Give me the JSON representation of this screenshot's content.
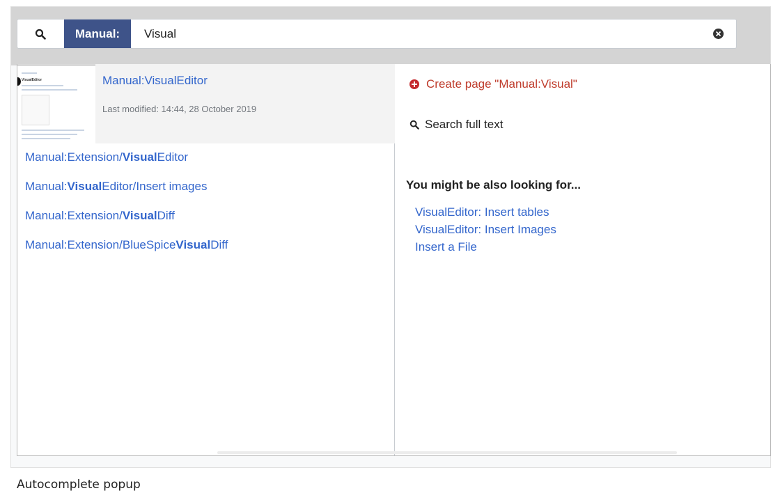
{
  "search": {
    "namespace_badge": "Manual:",
    "query": "Visual",
    "search_icon": "search-icon",
    "clear_icon": "clear-icon"
  },
  "top_result": {
    "title": "Manual:VisualEditor",
    "meta": "Last modified: 14:44, 28 October 2019",
    "thumbnail_title": "VisualEditor"
  },
  "results": [
    {
      "prefix": "Manual:Extension/",
      "match": "Visual",
      "suffix": "Editor"
    },
    {
      "prefix": "Manual:",
      "match": "Visual",
      "suffix": "Editor/Insert images"
    },
    {
      "prefix": "Manual:Extension/",
      "match": "Visual",
      "suffix": "Diff"
    },
    {
      "prefix": "Manual:Extension/BlueSpice",
      "match": "Visual",
      "suffix": "Diff"
    }
  ],
  "actions": {
    "create_page": "Create page \"Manual:Visual\"",
    "create_icon": "plus-circle-icon",
    "search_full_text": "Search full text"
  },
  "related": {
    "heading": "You might be also looking for...",
    "links": [
      "VisualEditor: Insert tables",
      "VisualEditor: Insert Images",
      "Insert a File"
    ]
  },
  "caption": "Autocomplete popup",
  "colors": {
    "link": "#3366cc",
    "badge": "#3e5389",
    "create": "#bf3c2c"
  }
}
